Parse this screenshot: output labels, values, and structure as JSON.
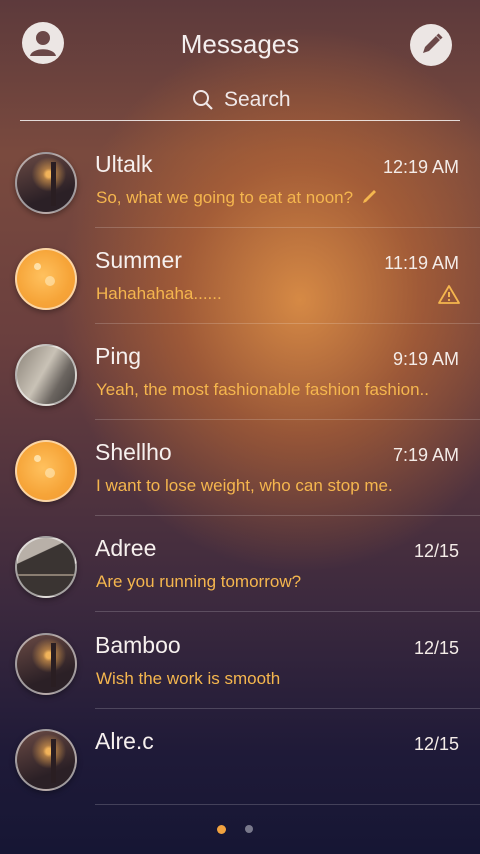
{
  "header": {
    "title": "Messages",
    "profile_icon": "person-icon",
    "compose_icon": "pencil-icon"
  },
  "search": {
    "placeholder": "Search",
    "icon": "search-icon"
  },
  "conversations": [
    {
      "name": "Ultalk",
      "time": "12:19 AM",
      "preview": "So, what we going to eat at noon?",
      "status_icon": "draft-pencil-icon",
      "avatar": "night-street"
    },
    {
      "name": "Summer",
      "time": "11:19 AM",
      "preview": "Hahahahaha......",
      "status_icon": "warning-icon",
      "avatar": "orange"
    },
    {
      "name": "Ping",
      "time": "9:19 AM",
      "preview": "Yeah, the most fashionable fashion fashion..",
      "avatar": "gray-photo"
    },
    {
      "name": "Shellho",
      "time": "7:19 AM",
      "preview": "I want to lose weight, who can stop me.",
      "avatar": "orange"
    },
    {
      "name": "Adree",
      "time": "12/15",
      "preview": "Are you running tomorrow?",
      "avatar": "stairs"
    },
    {
      "name": "Bamboo",
      "time": "12/15",
      "preview": "Wish the work is smooth",
      "avatar": "night-street"
    },
    {
      "name": "Alre.c",
      "time": "12/15",
      "preview": "",
      "avatar": "night-street"
    }
  ],
  "colors": {
    "accent": "#f5b64e",
    "text": "#f6f0ee"
  },
  "pager": {
    "pages": 2,
    "current": 1
  }
}
